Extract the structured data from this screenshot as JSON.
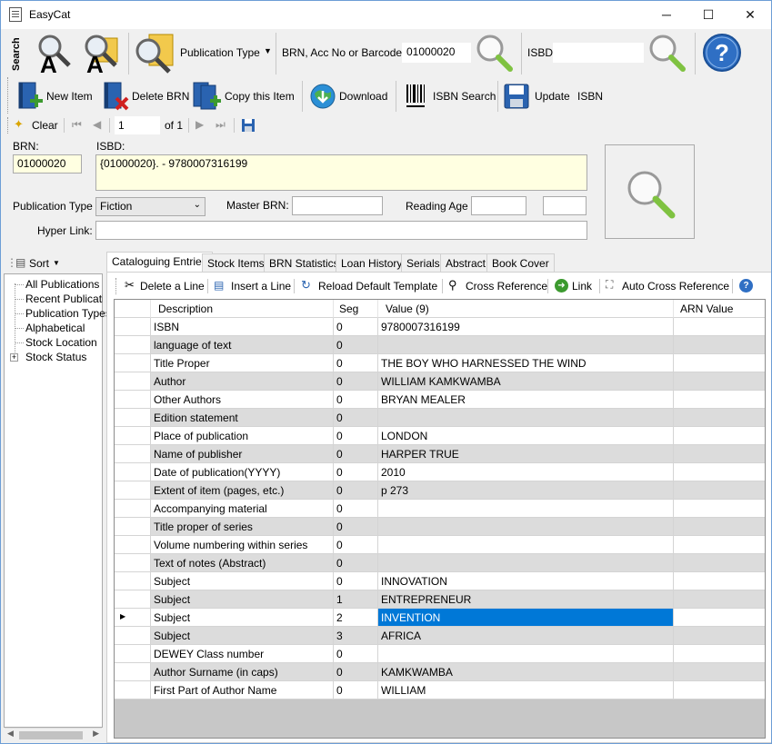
{
  "window": {
    "title": "EasyCat",
    "minimize": "─",
    "maximize": "☐",
    "close": "✕"
  },
  "toolbar1": {
    "search_label": "Search",
    "publication_type": "Publication Type",
    "brn_label": "BRN, Acc No or Barcode",
    "brn_value": "01000020",
    "isbd_label": "ISBD",
    "isbd_value": ""
  },
  "toolbar2": {
    "new_item": "New Item",
    "delete_brn": "Delete BRN",
    "copy_item": "Copy this Item",
    "download": "Download",
    "isbn_search": "ISBN Search",
    "update": "Update",
    "isbn": "ISBN"
  },
  "navigator": {
    "clear": "Clear",
    "position": "1",
    "of": "of 1"
  },
  "form": {
    "brn_label": "BRN:",
    "brn_value": "01000020",
    "isbd_label": "ISBD:",
    "isbd_value": "{01000020}. - 9780007316199",
    "pubtype_label": "Publication Type",
    "pubtype_value": "Fiction",
    "master_brn_label": "Master BRN:",
    "master_brn_value": "",
    "reading_age_label": "Reading Age",
    "reading_age_from": "",
    "reading_age_to": "",
    "hyperlink_label": "Hyper Link:",
    "hyperlink_value": ""
  },
  "sidebar": {
    "sort_label": "Sort",
    "items": [
      {
        "label": "All Publications"
      },
      {
        "label": "Recent Publications"
      },
      {
        "label": "Publication Types"
      },
      {
        "label": "Alphabetical"
      },
      {
        "label": "Stock Location"
      },
      {
        "label": "Stock Status"
      }
    ]
  },
  "tabs": [
    {
      "label": "Cataloguing Entries"
    },
    {
      "label": "Stock Items"
    },
    {
      "label": "BRN Statistics"
    },
    {
      "label": "Loan History"
    },
    {
      "label": "Serials"
    },
    {
      "label": "Abstract"
    },
    {
      "label": "Book Cover"
    }
  ],
  "grid_toolbar": {
    "delete_line": "Delete a Line",
    "insert_line": "Insert a Line",
    "reload": "Reload Default Template",
    "cross_ref": "Cross Reference",
    "link": "Link",
    "auto_cross": "Auto Cross Reference"
  },
  "grid": {
    "headers": {
      "description": "Description",
      "seg": "Seg",
      "value": "Value (9)",
      "arn": "ARN Value"
    },
    "rows": [
      {
        "description": "ISBN",
        "seg": "0",
        "value": "9780007316199",
        "arn": ""
      },
      {
        "description": "language of text",
        "seg": "0",
        "value": "",
        "arn": ""
      },
      {
        "description": "Title Proper",
        "seg": "0",
        "value": "THE BOY WHO HARNESSED THE WIND",
        "arn": ""
      },
      {
        "description": "Author",
        "seg": "0",
        "value": "WILLIAM KAMKWAMBA",
        "arn": ""
      },
      {
        "description": "Other Authors",
        "seg": "0",
        "value": "BRYAN MEALER",
        "arn": ""
      },
      {
        "description": "Edition statement",
        "seg": "0",
        "value": "",
        "arn": ""
      },
      {
        "description": "Place of publication",
        "seg": "0",
        "value": "LONDON",
        "arn": ""
      },
      {
        "description": "Name of publisher",
        "seg": "0",
        "value": "HARPER TRUE",
        "arn": ""
      },
      {
        "description": "Date of publication(YYYY)",
        "seg": "0",
        "value": "2010",
        "arn": ""
      },
      {
        "description": "Extent of item (pages, etc.)",
        "seg": "0",
        "value": "p 273",
        "arn": ""
      },
      {
        "description": "Accompanying material",
        "seg": "0",
        "value": "",
        "arn": ""
      },
      {
        "description": "Title proper of series",
        "seg": "0",
        "value": "",
        "arn": ""
      },
      {
        "description": "Volume numbering within series",
        "seg": "0",
        "value": "",
        "arn": ""
      },
      {
        "description": "Text of notes (Abstract)",
        "seg": "0",
        "value": "",
        "arn": ""
      },
      {
        "description": "Subject",
        "seg": "0",
        "value": "INNOVATION",
        "arn": ""
      },
      {
        "description": "Subject",
        "seg": "1",
        "value": "ENTREPRENEUR",
        "arn": ""
      },
      {
        "description": "Subject",
        "seg": "2",
        "value": "INVENTION",
        "arn": ""
      },
      {
        "description": "Subject",
        "seg": "3",
        "value": "AFRICA",
        "arn": ""
      },
      {
        "description": "DEWEY Class number",
        "seg": "0",
        "value": "",
        "arn": ""
      },
      {
        "description": "Author Surname (in caps)",
        "seg": "0",
        "value": "KAMKWAMBA",
        "arn": ""
      },
      {
        "description": "First Part of Author Name",
        "seg": "0",
        "value": "WILLIAM",
        "arn": ""
      }
    ]
  },
  "colors": {
    "selected": "#0078d7",
    "alt_row": "#dcdcdc",
    "isbd_bg": "#ffffe1"
  }
}
